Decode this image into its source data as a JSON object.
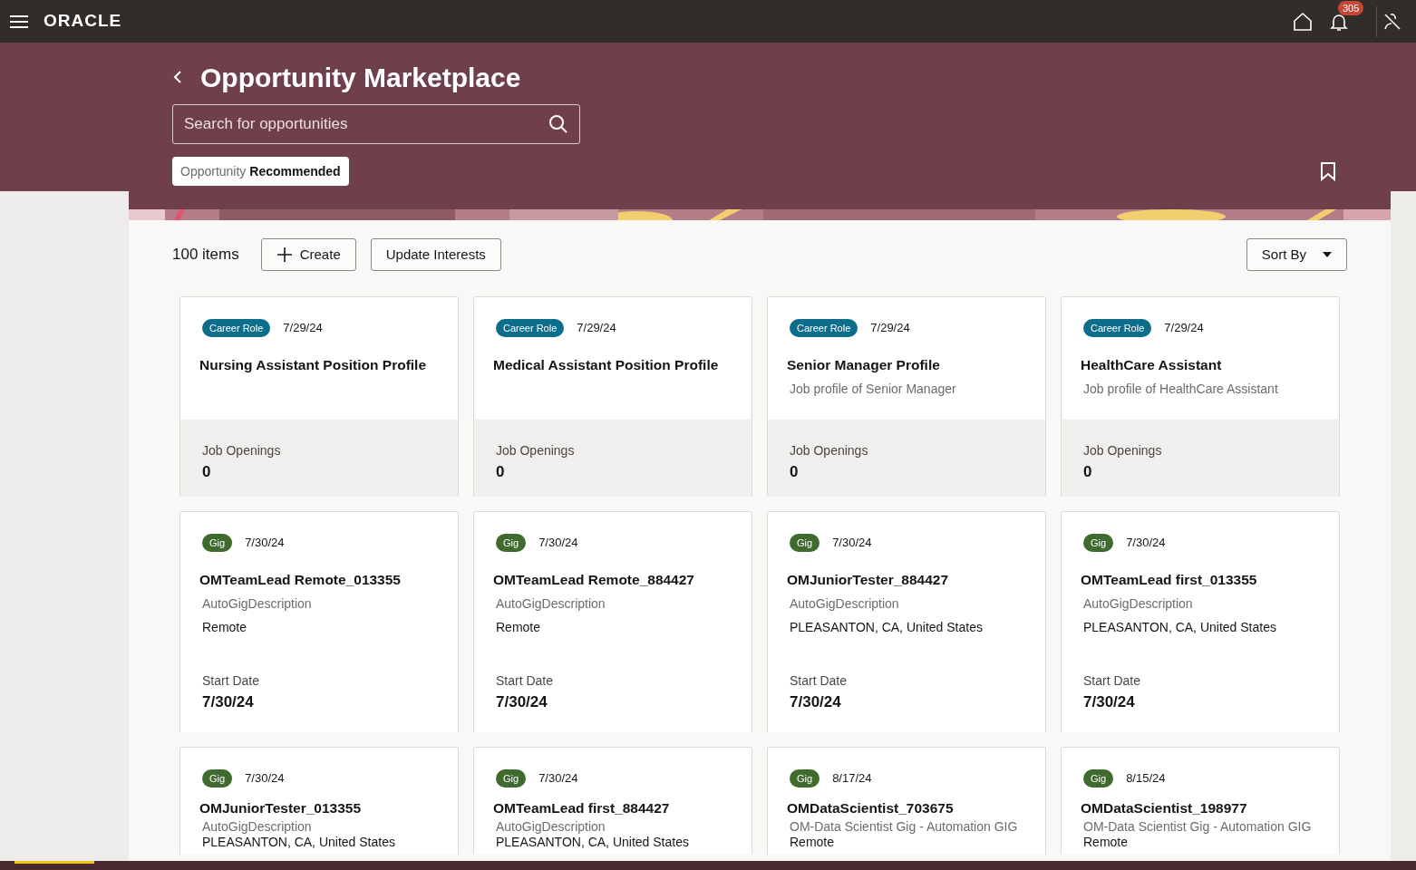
{
  "top_bar": {
    "logo": "ORACLE",
    "notification_count": "305"
  },
  "header": {
    "title": "Opportunity Marketplace",
    "search": {
      "placeholder": "Search for opportunities"
    },
    "chip": {
      "label": "Opportunity",
      "value": "Recommended"
    }
  },
  "toolbar": {
    "count": "100 items",
    "buttons": [
      "Create",
      "Update Interests"
    ],
    "sort": "Sort By"
  },
  "cards": [
    {
      "kind": "career",
      "tag": "Career Role",
      "date": "7/29/24",
      "title": "Nursing Assistant Position Profile",
      "footer_label": "Job Openings",
      "footer_value": "0"
    },
    {
      "kind": "career",
      "tag": "Career Role",
      "date": "7/29/24",
      "title": "Medical Assistant Position Profile",
      "footer_label": "Job Openings",
      "footer_value": "0"
    },
    {
      "kind": "career",
      "tag": "Career Role",
      "date": "7/29/24",
      "title": "Senior Manager Profile",
      "subtitle": "Job profile of Senior Manager",
      "footer_label": "Job Openings",
      "footer_value": "0"
    },
    {
      "kind": "career",
      "tag": "Career Role",
      "date": "7/29/24",
      "title": "HealthCare Assistant",
      "subtitle": "Job profile of HealthCare Assistant",
      "footer_label": "Job Openings",
      "footer_value": "0"
    },
    {
      "kind": "gig",
      "tag": "Gig",
      "date": "7/30/24",
      "title": "OMTeamLead Remote_013355",
      "subtitle": "AutoGigDescription",
      "location": "Remote",
      "footer_label": "Start Date",
      "footer_value": "7/30/24"
    },
    {
      "kind": "gig",
      "tag": "Gig",
      "date": "7/30/24",
      "title": "OMTeamLead Remote_884427",
      "subtitle": "AutoGigDescription",
      "location": "Remote",
      "footer_label": "Start Date",
      "footer_value": "7/30/24"
    },
    {
      "kind": "gig",
      "tag": "Gig",
      "date": "7/30/24",
      "title": "OMJuniorTester_884427",
      "subtitle": "AutoGigDescription",
      "location": "PLEASANTON, CA, United States",
      "footer_label": "Start Date",
      "footer_value": "7/30/24"
    },
    {
      "kind": "gig",
      "tag": "Gig",
      "date": "7/30/24",
      "title": "OMTeamLead first_013355",
      "subtitle": "AutoGigDescription",
      "location": "PLEASANTON, CA, United States",
      "footer_label": "Start Date",
      "footer_value": "7/30/24"
    },
    {
      "kind": "gig",
      "tag": "Gig",
      "date": "7/30/24",
      "title": "OMJuniorTester_013355",
      "subtitle": "AutoGigDescription",
      "location": "PLEASANTON, CA, United States"
    },
    {
      "kind": "gig",
      "tag": "Gig",
      "date": "7/30/24",
      "title": "OMTeamLead first_884427",
      "subtitle": "AutoGigDescription",
      "location": "PLEASANTON, CA, United States"
    },
    {
      "kind": "gig",
      "tag": "Gig",
      "date": "8/17/24",
      "title": "OMDataScientist_703675",
      "subtitle": "OM-Data Scientist Gig - Automation GIG",
      "location": "Remote"
    },
    {
      "kind": "gig",
      "tag": "Gig",
      "date": "8/15/24",
      "title": "OMDataScientist_198977",
      "subtitle": "OM-Data Scientist Gig - Automation GIG",
      "location": "Remote"
    }
  ]
}
